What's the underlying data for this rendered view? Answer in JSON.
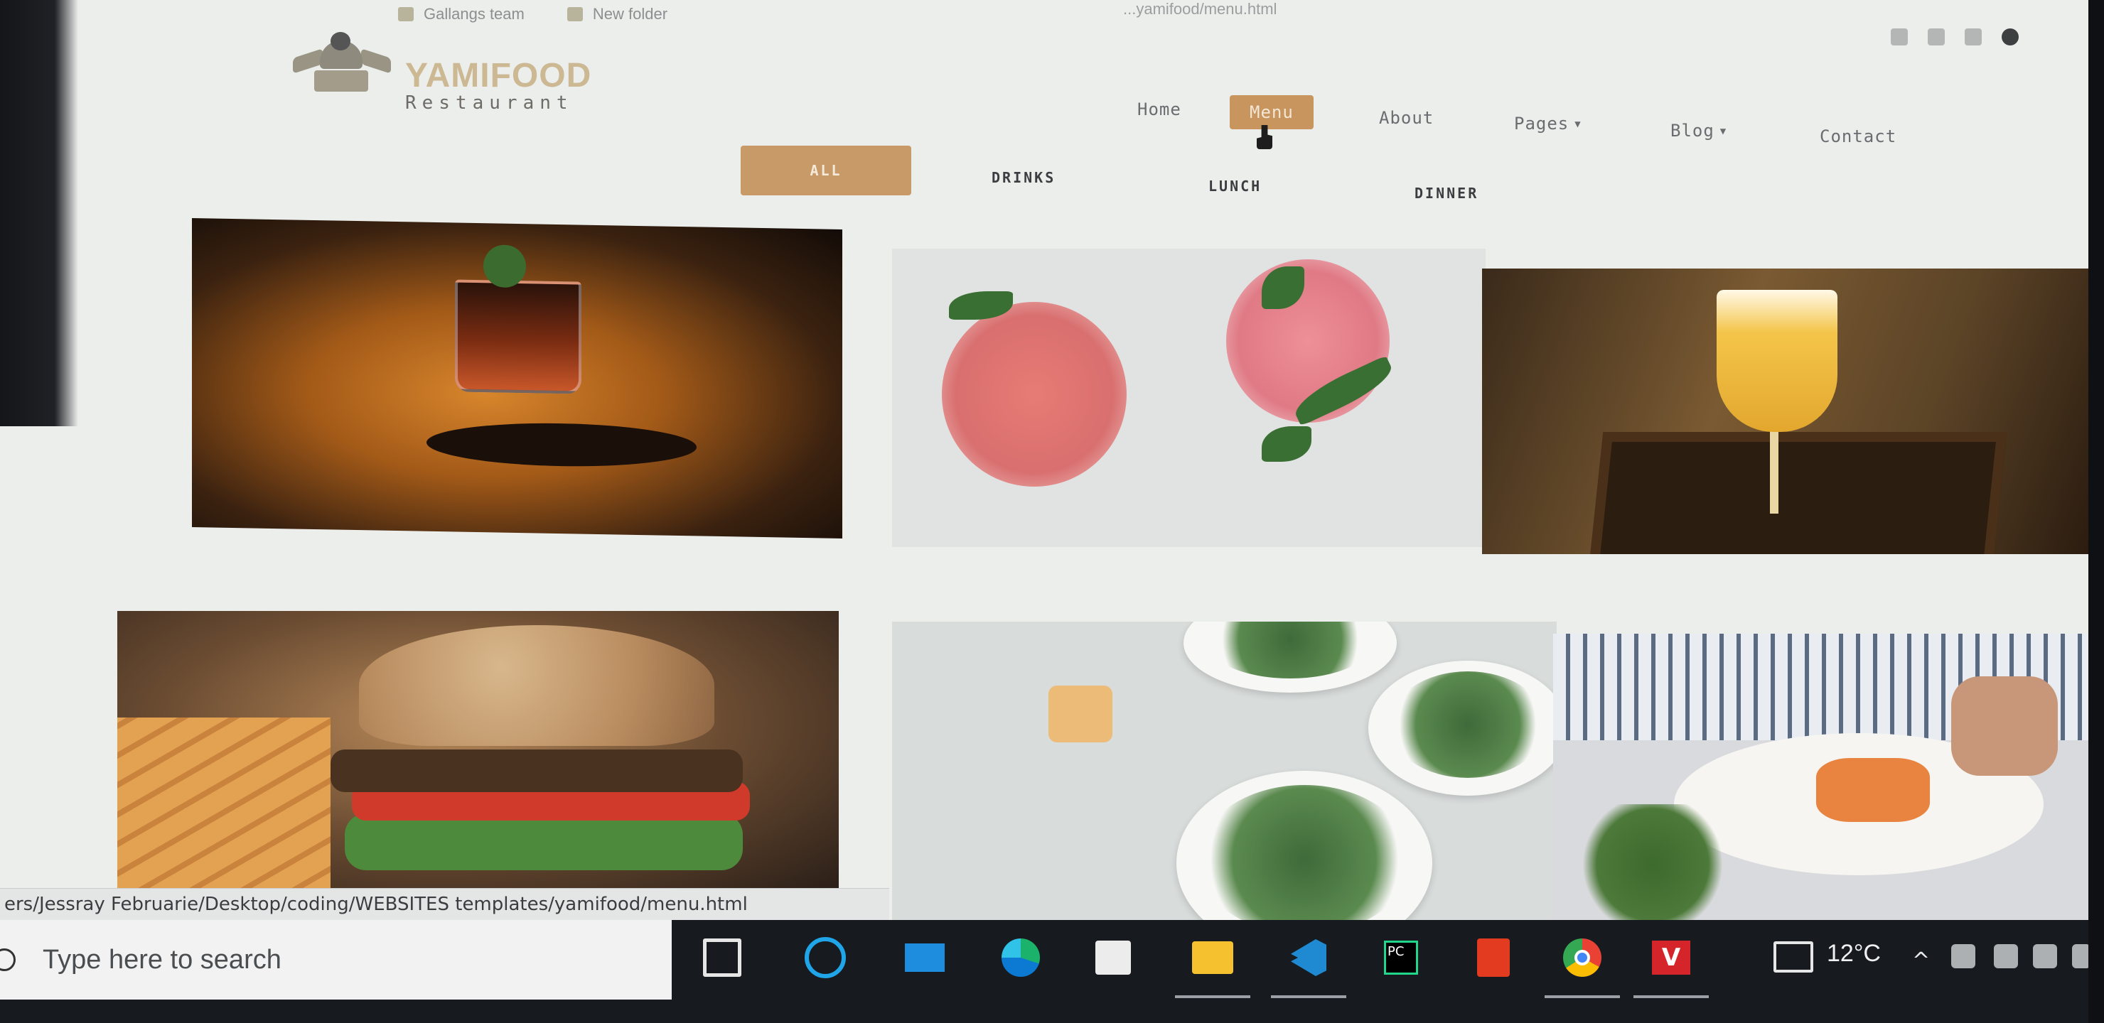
{
  "browser": {
    "bookmarks": [
      "Gallangs team",
      "New folder"
    ],
    "url_fragment": "...yamifood/menu.html"
  },
  "site": {
    "logo_name": "YAMIFOOD",
    "logo_sub": "Restaurant",
    "nav": [
      {
        "label": "Home",
        "active": false
      },
      {
        "label": "Menu",
        "active": true
      },
      {
        "label": "About",
        "active": false
      },
      {
        "label": "Pages",
        "active": false,
        "dropdown": true
      },
      {
        "label": "Blog",
        "active": false,
        "dropdown": true
      },
      {
        "label": "Contact",
        "active": false
      }
    ],
    "caret": "▼",
    "filters": [
      {
        "label": "ALL",
        "active": true
      },
      {
        "label": "DRINKS",
        "active": false
      },
      {
        "label": "LUNCH",
        "active": false
      },
      {
        "label": "DINNER",
        "active": false
      }
    ],
    "accent_color": "#c8955f"
  },
  "status_bar": {
    "url": "ers/Jessray Februarie/Desktop/coding/WEBSITES templates/yamifood/menu.html"
  },
  "taskbar": {
    "search_placeholder": "Type here to search",
    "apps": [
      "task-view",
      "cortana",
      "mail",
      "edge",
      "store",
      "file-explorer",
      "vscode",
      "pycharm",
      "office",
      "chrome",
      "app-v"
    ],
    "pycharm_label": "PC",
    "app_v_label": "V",
    "temperature": "12°C",
    "chevron": "^"
  }
}
